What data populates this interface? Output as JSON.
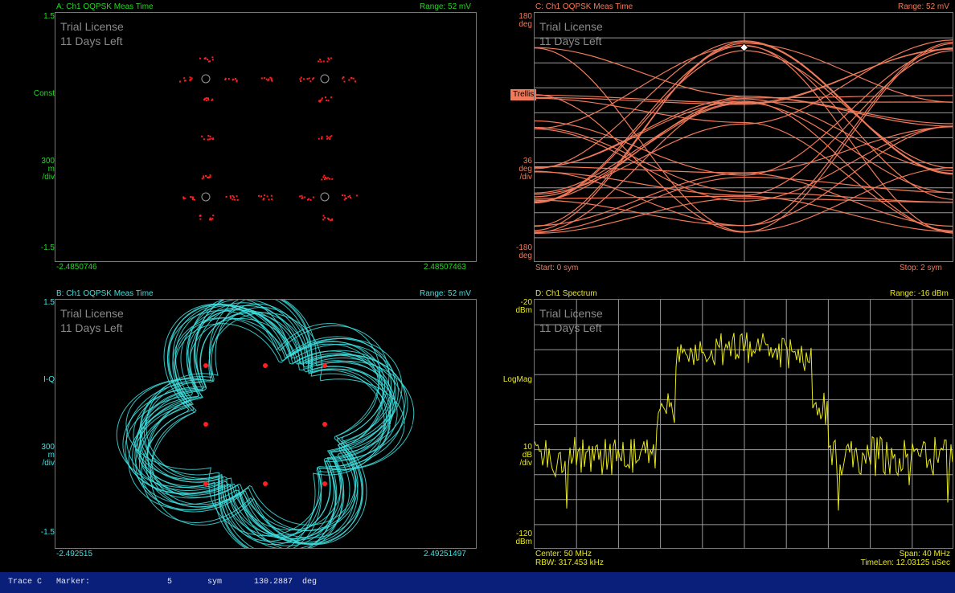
{
  "colors": {
    "green": "#22d822",
    "salmon": "#f07a5a",
    "cyan": "#3fe0e0",
    "yellow": "#e8e820",
    "red": "#ff2020",
    "grid": "#9a9a9a",
    "status_bg": "#0a1f7a"
  },
  "watermark": {
    "line1": "Trial License",
    "line2": "11 Days Left"
  },
  "panes": {
    "a": {
      "title": "A: Ch1 OQPSK Meas Time",
      "range": "Range: 52 mV",
      "y_top": "1.5",
      "y_mode": "Const",
      "y_scale": [
        "300",
        "m",
        "/div"
      ],
      "y_bottom": "-1.5",
      "x_left": "-2.4850746",
      "x_right": "2.48507463"
    },
    "b": {
      "title": "B: Ch1 OQPSK Meas Time",
      "range": "Range: 52 mV",
      "y_top": "1.5",
      "y_mode": "I-Q",
      "y_scale": [
        "300",
        "m",
        "/div"
      ],
      "y_bottom": "-1.5",
      "x_left": "-2.492515",
      "x_right": "2.49251497"
    },
    "c": {
      "title": "C: Ch1 OQPSK Meas Time",
      "range": "Range: 52 mV",
      "y_top": [
        "180",
        "deg"
      ],
      "y_mode": "Trellis",
      "y_scale": [
        "36",
        "deg",
        "/div"
      ],
      "y_bottom": [
        "-180",
        "deg"
      ],
      "x_left": "Start: 0  sym",
      "x_right": "Stop: 2  sym"
    },
    "d": {
      "title": "D: Ch1 Spectrum",
      "range": "Range: -16 dBm",
      "y_top": [
        "-20",
        "dBm"
      ],
      "y_mode": "LogMag",
      "y_scale": [
        "10",
        "dB",
        "/div"
      ],
      "y_bottom": [
        "-120",
        "dBm"
      ],
      "x_left_1": "Center: 50 MHz",
      "x_left_2": "RBW: 317.453 kHz",
      "x_right_1": "Span: 40 MHz",
      "x_right_2": "TimeLen: 12.03125 uSec"
    }
  },
  "status": {
    "trace": "Trace C",
    "marker_label": "Marker:",
    "marker_x": "5",
    "marker_x_unit": "sym",
    "marker_y": "130.2887",
    "marker_y_unit": "deg"
  }
}
